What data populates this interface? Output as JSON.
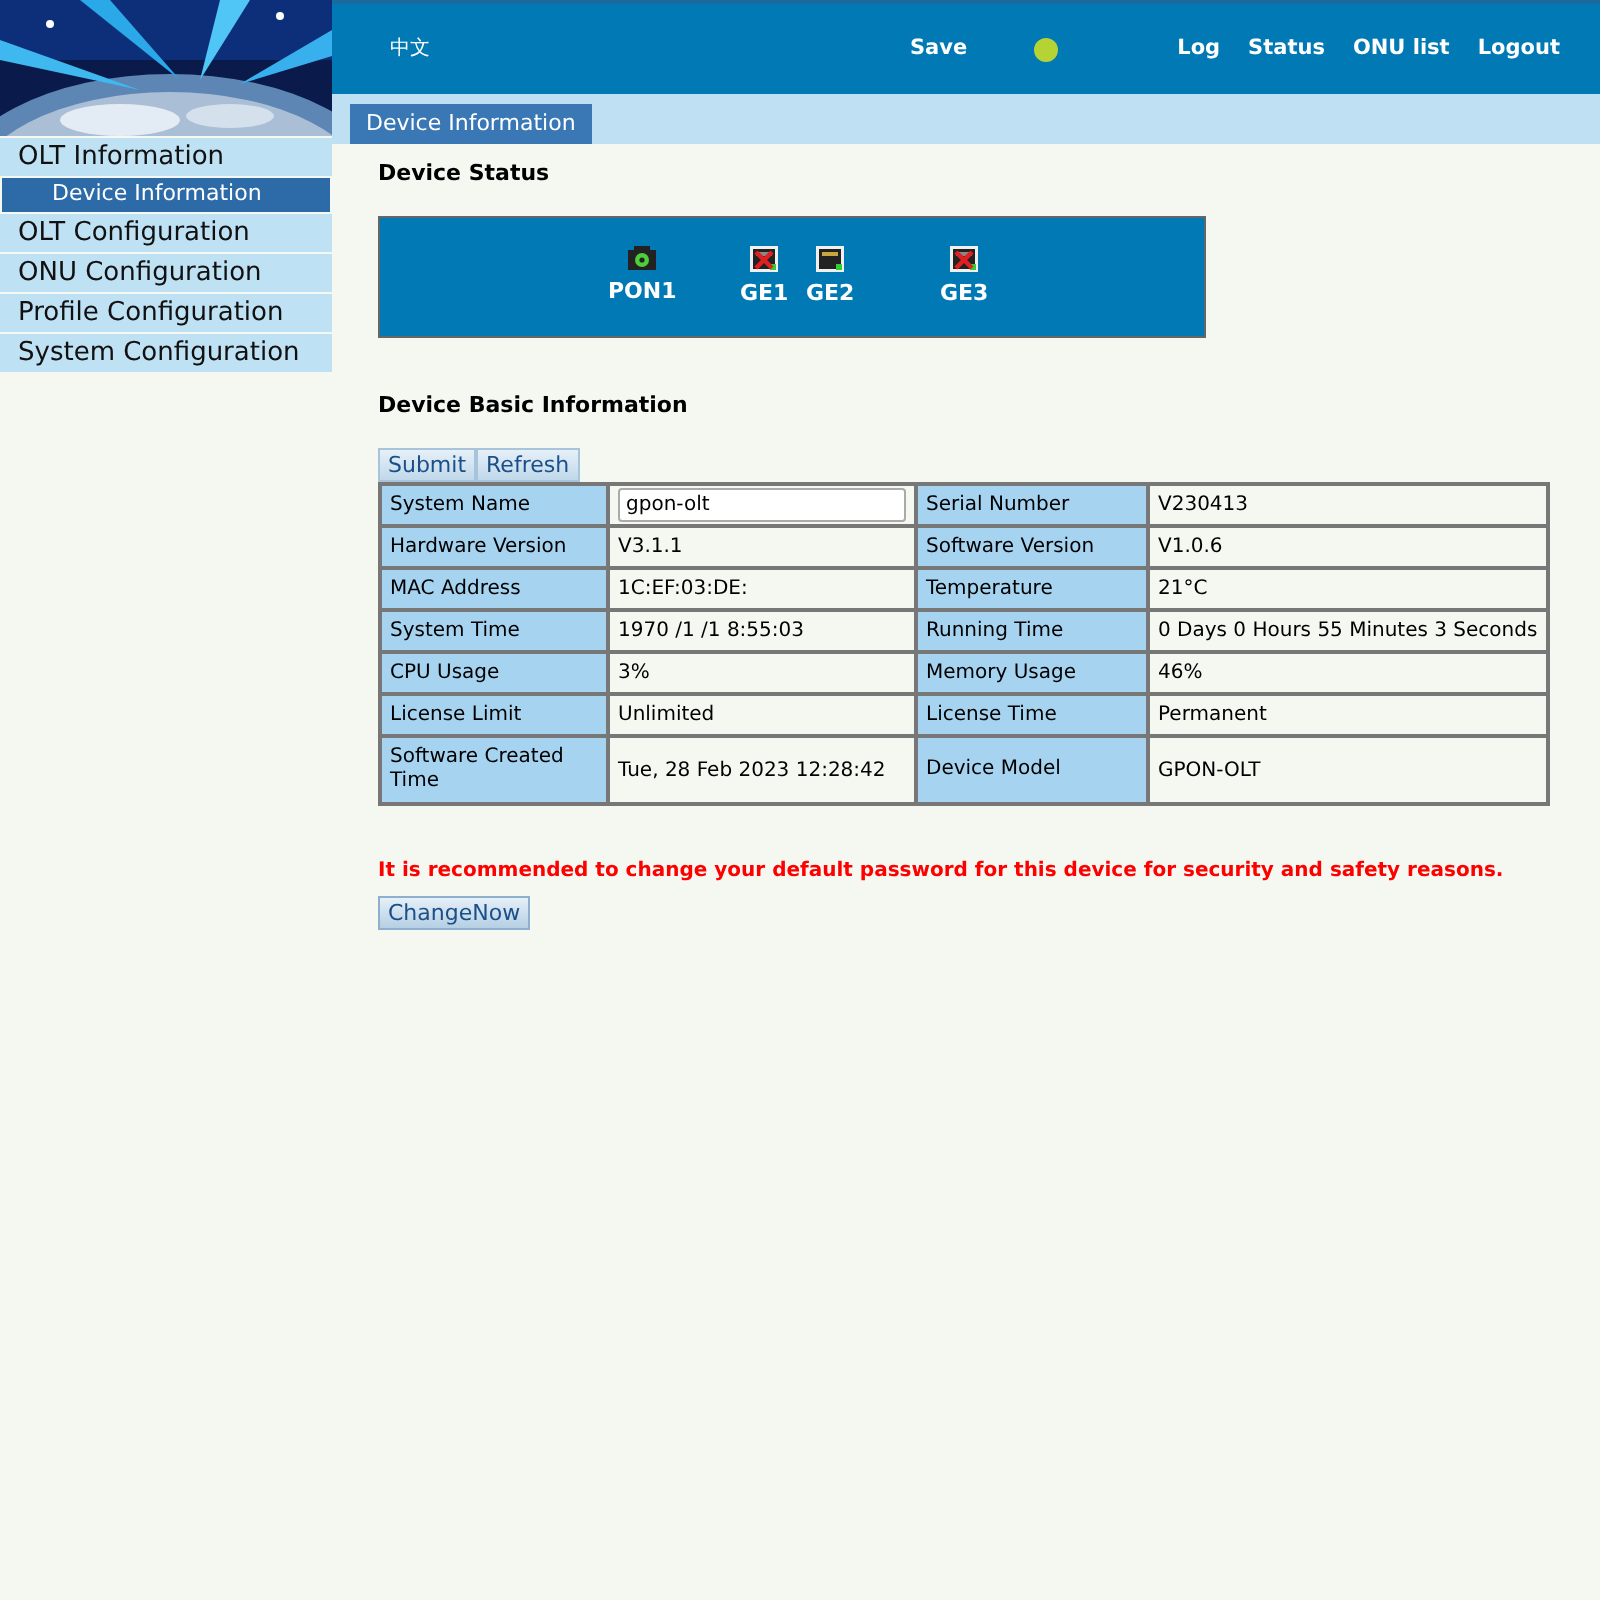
{
  "header": {
    "language": "中文",
    "save": "Save",
    "save_status": {
      "color": "#b5d334"
    },
    "links": [
      "Log",
      "Status",
      "ONU list",
      "Logout"
    ]
  },
  "sidebar": {
    "items": [
      {
        "label": "OLT Information",
        "children": [
          {
            "label": "Device Information",
            "selected": true
          }
        ]
      },
      {
        "label": "OLT Configuration"
      },
      {
        "label": "ONU Configuration"
      },
      {
        "label": "Profile Configuration"
      },
      {
        "label": "System Configuration"
      }
    ]
  },
  "tabs": [
    {
      "label": "Device Information",
      "selected": true
    }
  ],
  "device_status": {
    "title": "Device Status",
    "ports": [
      {
        "label": "PON1",
        "kind": "pon",
        "up": true
      },
      {
        "label": "GE1",
        "kind": "ge",
        "up": false
      },
      {
        "label": "GE2",
        "kind": "ge",
        "up": true
      },
      {
        "label": "GE3",
        "kind": "ge",
        "up": false
      }
    ]
  },
  "basic_info": {
    "title": "Device Basic Information",
    "buttons": [
      "Submit",
      "Refresh"
    ],
    "rows": [
      [
        {
          "label": "System Name",
          "value": "gpon-olt",
          "kind": "input"
        },
        {
          "label": "Serial Number",
          "value": "V230413"
        }
      ],
      [
        {
          "label": "Hardware Version",
          "value": "V3.1.1"
        },
        {
          "label": "Software Version",
          "value": "V1.0.6"
        }
      ],
      [
        {
          "label": "MAC Address",
          "value": "1C:EF:03:DE:"
        },
        {
          "label": "Temperature",
          "value": "21°C"
        }
      ],
      [
        {
          "label": "System Time",
          "value": "1970 /1 /1 8:55:03"
        },
        {
          "label": "Running Time",
          "value": "0 Days 0 Hours 55 Minutes 3 Seconds"
        }
      ],
      [
        {
          "label": "CPU Usage",
          "value": "3%"
        },
        {
          "label": "Memory Usage",
          "value": "46%"
        }
      ],
      [
        {
          "label": "License Limit",
          "value": "Unlimited"
        },
        {
          "label": "License Time",
          "value": "Permanent"
        }
      ],
      [
        {
          "label": "Software Created Time",
          "value": "Tue, 28 Feb 2023 12:28:42"
        },
        {
          "label": "Device Model",
          "value": "GPON-OLT"
        }
      ]
    ]
  },
  "warning": {
    "text": "It is recommended to change your default password for this device for security and safety reasons.",
    "button": "ChangeNow"
  }
}
